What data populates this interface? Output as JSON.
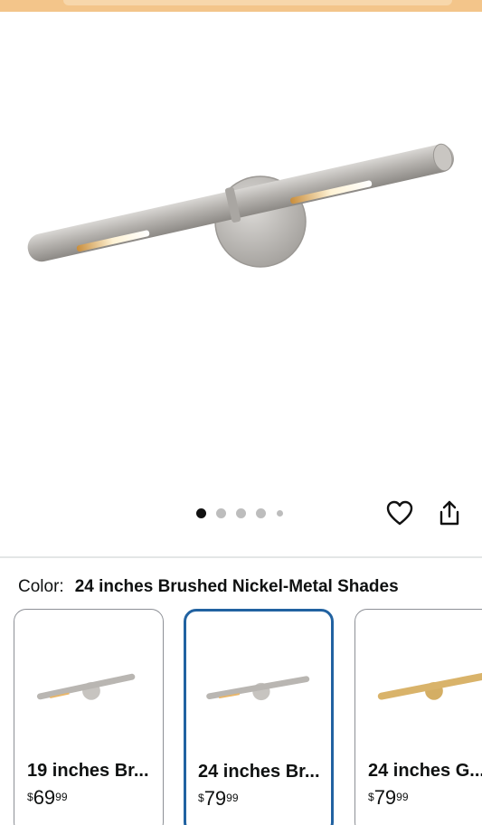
{
  "product": {
    "image_alt": "Brushed nickel picture light",
    "carousel": {
      "count": 5,
      "active_index": 0
    },
    "actions": {
      "favorite_icon": "heart-icon",
      "share_icon": "share-icon"
    }
  },
  "variation": {
    "label": "Color:",
    "selected_value": "24 inches Brushed Nickel-Metal Shades"
  },
  "swatches": [
    {
      "name": "19 inches Br...",
      "currency": "$",
      "whole": "69",
      "fraction": "99",
      "finish": "nickel",
      "selected": false
    },
    {
      "name": "24 inches Br...",
      "currency": "$",
      "whole": "79",
      "fraction": "99",
      "finish": "nickel",
      "selected": true
    },
    {
      "name": "24 inches G...",
      "currency": "$",
      "whole": "79",
      "fraction": "99",
      "finish": "gold",
      "selected": false
    }
  ],
  "colors": {
    "selected_border": "#2162a1",
    "nickel": "#b9b6b2",
    "gold": "#d9b36a"
  }
}
